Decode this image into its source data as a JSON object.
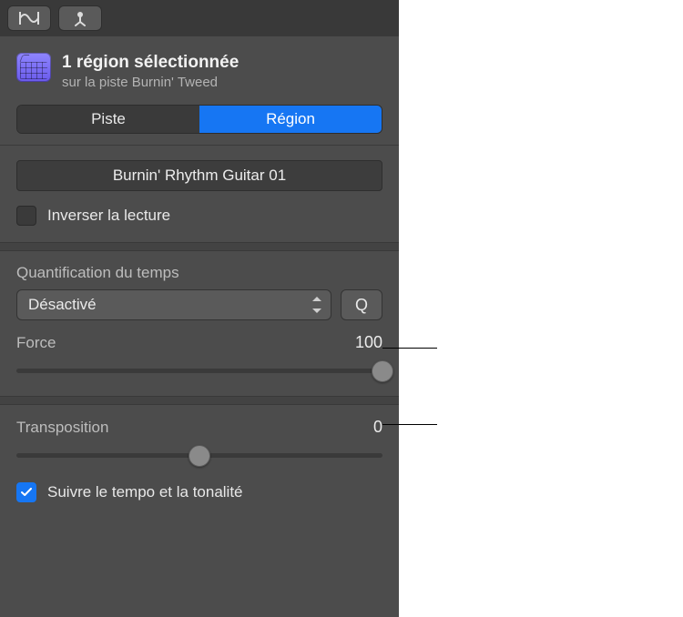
{
  "header": {
    "title": "1 région sélectionnée",
    "subtitle": "sur la piste Burnin' Tweed"
  },
  "tabs": {
    "track": "Piste",
    "region": "Région"
  },
  "region_name": "Burnin' Rhythm Guitar 01",
  "reverse": {
    "label": "Inverser la lecture",
    "checked": false
  },
  "quantize": {
    "label": "Quantification du temps",
    "value": "Désactivé",
    "q_button": "Q",
    "strength_label": "Force",
    "strength_value": "100",
    "strength_percent": 100
  },
  "transpose": {
    "label": "Transposition",
    "value": "0",
    "percent": 50
  },
  "follow": {
    "label": "Suivre le tempo et la tonalité",
    "checked": true
  }
}
